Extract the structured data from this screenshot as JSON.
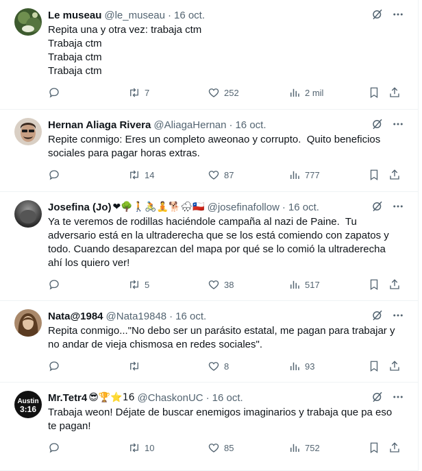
{
  "tweets": [
    {
      "name": "Le museau",
      "emoji": "",
      "handle": "@le_museau",
      "date": "16 oct.",
      "text": "Repita una y otra vez: trabaja ctm\nTrabaja ctm\nTrabaja ctm\nTrabaja ctm",
      "replies": "",
      "retweets": "7",
      "likes": "252",
      "views": "2 mil",
      "avatar_color": "#4c6b3d"
    },
    {
      "name": "Hernan Aliaga Rivera",
      "emoji": "",
      "handle": "@AliagaHernan",
      "date": "16 oct.",
      "text": "Repite conmigo: Eres un completo aweonao y corrupto.  Quito beneficios sociales para pagar horas extras.",
      "replies": "",
      "retweets": "14",
      "likes": "87",
      "views": "777",
      "avatar_color": "#8a7a6a"
    },
    {
      "name": "Josefina (Jo)",
      "emoji": "❤🌳🚶🚴🧘🐕🌧🇨🇱",
      "handle": "@josefinafollow",
      "date": "16 oct.",
      "text": "Ya te veremos de rodillas haciéndole campaña al nazi de Paine.  Tu adversario está en la ultraderecha que se los está comiendo con zapatos y todo. Cuando desaparezcan del mapa por qué se lo comió la ultraderecha ahí los quiero ver!",
      "replies": "",
      "retweets": "5",
      "likes": "38",
      "views": "517",
      "avatar_color": "#5a5a5a"
    },
    {
      "name": "Nata@1984",
      "emoji": "",
      "handle": "@Nata19848",
      "date": "16 oct.",
      "text": "Repita conmigo...\"No debo ser un parásito estatal, me pagan para trabajar y no andar de vieja chismosa en redes sociales\".",
      "replies": "",
      "retweets": "",
      "likes": "8",
      "views": "93",
      "avatar_color": "#7a5a3e"
    },
    {
      "name": "Mr.Tetr4",
      "emoji": "😎🏆⭐16",
      "handle": "@ChaskonUC",
      "date": "16 oct.",
      "text": "Trabaja weon! Déjate de buscar enemigos imaginarios y trabaja que pa eso te pagan!",
      "replies": "",
      "retweets": "10",
      "likes": "85",
      "views": "752",
      "avatar_color": "#111111",
      "avatar_text": "Austin\n3:16"
    }
  ],
  "icons": {
    "grok": "grok-icon",
    "more": "more-icon",
    "reply": "reply-icon",
    "retweet": "retweet-icon",
    "like": "heart-icon",
    "views": "views-icon",
    "bookmark": "bookmark-icon",
    "share": "share-icon"
  },
  "colors": {
    "text": "#0f1419",
    "secondary": "#536471",
    "heart": "#f91880"
  }
}
